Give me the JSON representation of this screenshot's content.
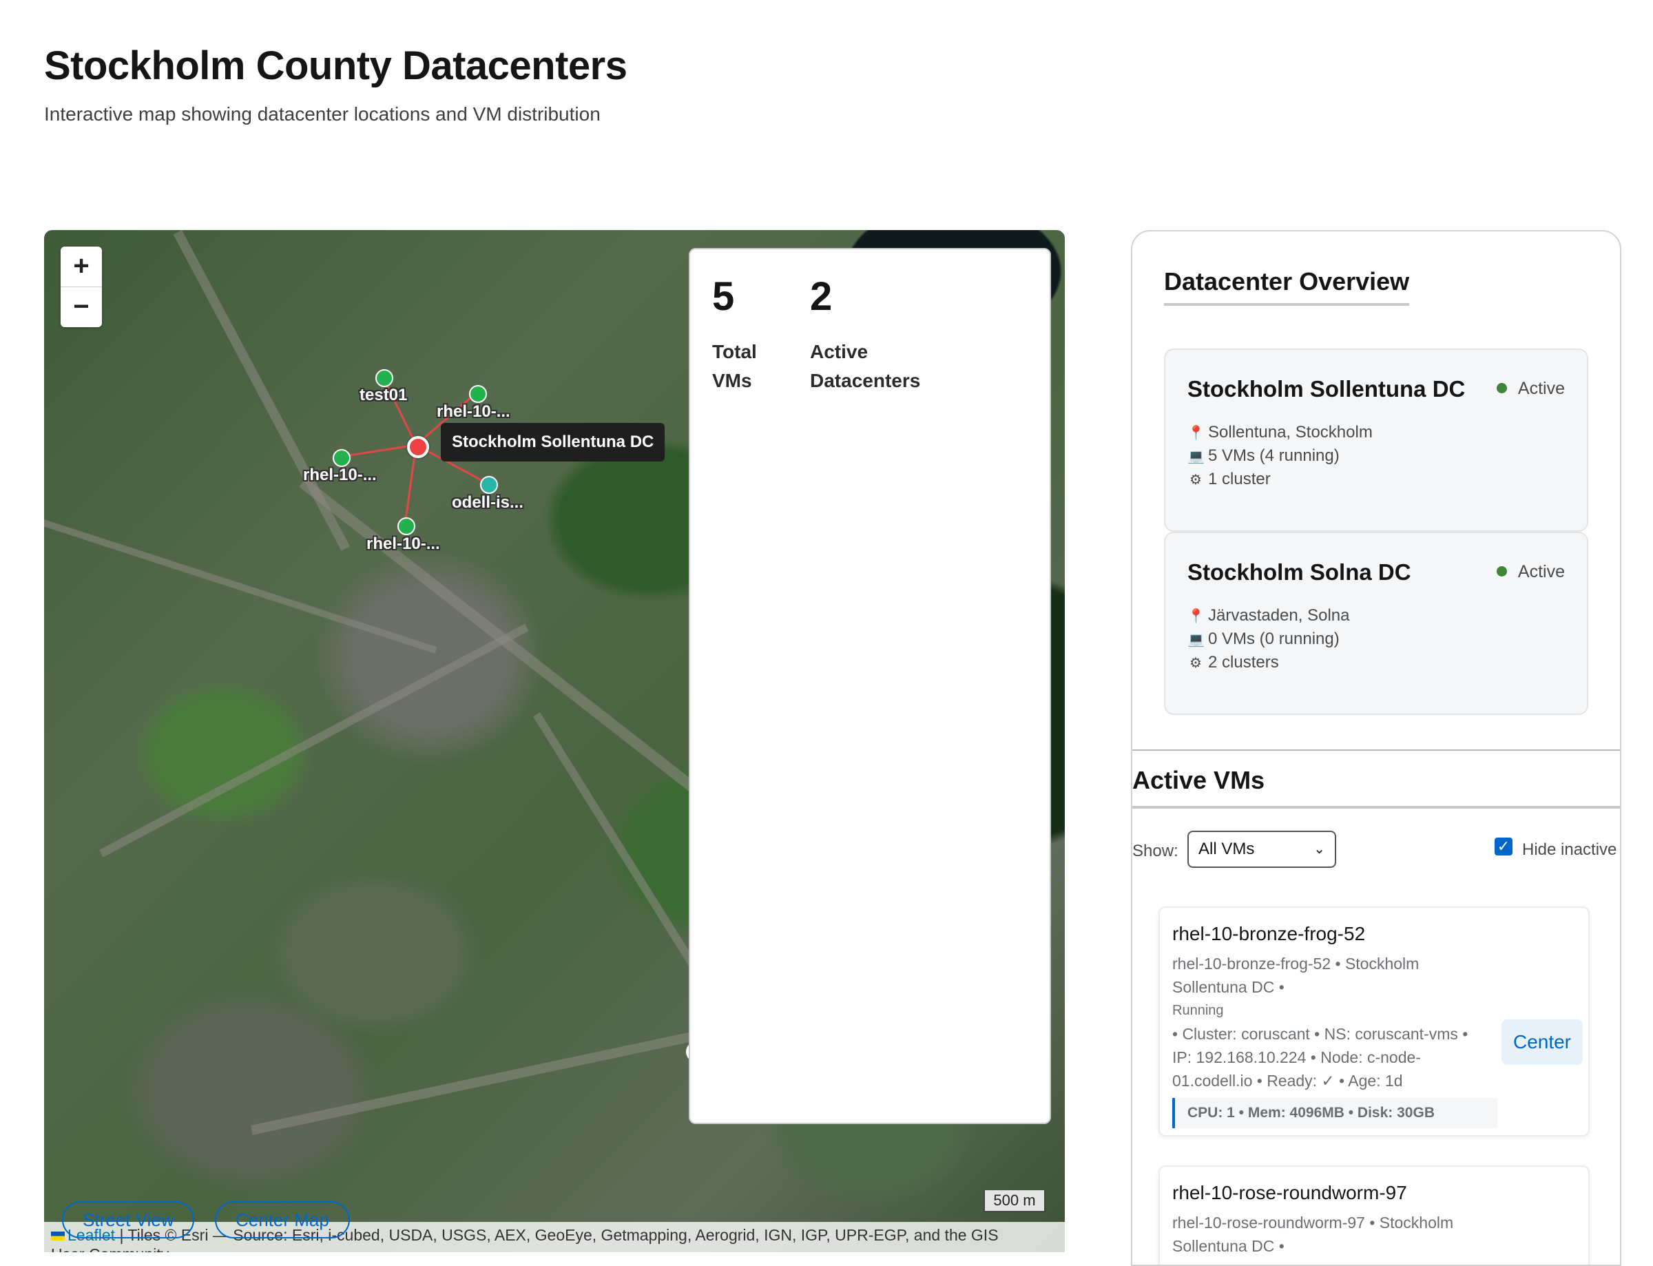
{
  "header": {
    "title": "Stockholm County Datacenters",
    "subtitle": "Interactive map showing datacenter locations and VM distribution"
  },
  "map": {
    "zoom_in": "+",
    "zoom_out": "−",
    "stats": {
      "total_vms_value": "5",
      "total_vms_label": "Total VMs",
      "active_dc_value": "2",
      "active_dc_label": "Active Datacenters"
    },
    "dc_tooltip": "Stockholm Sollentuna DC",
    "markers": [
      {
        "label": "test01",
        "color": "#22b14c"
      },
      {
        "label": "rhel-10-...",
        "color": "#22b14c"
      },
      {
        "label": "rhel-10-...",
        "color": "#22b14c"
      },
      {
        "label": "odell-is...",
        "color": "#26b5a6"
      },
      {
        "label": "rhel-10-...",
        "color": "#22b14c"
      }
    ],
    "scale": "500 m",
    "attribution_leaflet": "Leaflet",
    "attribution_rest": "| Tiles © Esri — Source: Esri, i-cubed, USDA, USGS, AEX, GeoEye, Getmapping, Aerogrid, IGN, IGP, UPR-EGP, and the GIS",
    "attribution_line2": "User Community",
    "street_view": "Street View",
    "center_map": "Center Map"
  },
  "panel": {
    "heading": "Datacenter Overview",
    "datacenters": [
      {
        "name": "Stockholm Sollentuna DC",
        "status": "Active",
        "location": "Sollentuna, Stockholm",
        "vms": "5 VMs (4 running)",
        "clusters": "1 cluster"
      },
      {
        "name": "Stockholm Solna DC",
        "status": "Active",
        "location": "Järvastaden, Solna",
        "vms": "0 VMs (0 running)",
        "clusters": "2 clusters"
      }
    ],
    "vms_heading": "Active VMs",
    "show_label": "Show:",
    "show_selected": "All VMs",
    "hide_inactive_label": "Hide inactive",
    "hide_inactive_checked": true,
    "vms": [
      {
        "name": "rhel-10-bronze-frog-52",
        "meta_line1": "rhel-10-bronze-frog-52 • Stockholm",
        "meta_line2": "Sollentuna DC •",
        "status": "Running",
        "meta_line3": "• Cluster: coruscant • NS: coruscant-vms •",
        "meta_line4": "IP: 192.168.10.224 • Node: c-node-",
        "meta_line5": "01.codell.io • Ready: ✓ • Age: 1d",
        "resources": "CPU: 1 • Mem: 4096MB • Disk: 30GB",
        "center": "Center"
      },
      {
        "name": "rhel-10-rose-roundworm-97",
        "meta_line1": "rhel-10-rose-roundworm-97 • Stockholm",
        "meta_line2": "Sollentuna DC •"
      }
    ]
  },
  "colors": {
    "accent": "#0066cc",
    "active": "#3e8635",
    "dc_marker": "#ee4242",
    "vm_marker": "#22b14c"
  }
}
